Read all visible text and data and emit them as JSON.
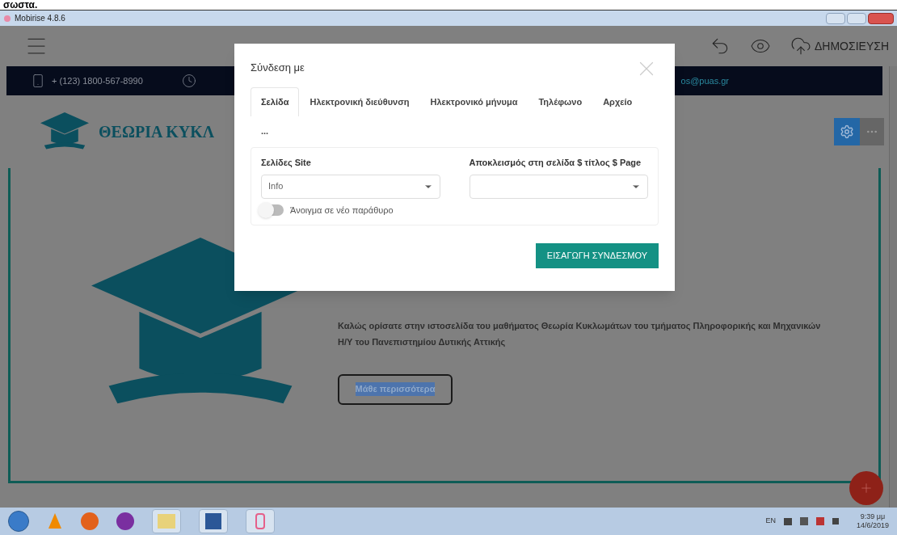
{
  "caption": "σωστα.",
  "window": {
    "title": "Mobirise 4.8.6"
  },
  "toolbar": {
    "publish": "ΔΗΜΟΣΙΕΥΣΗ"
  },
  "contact_bar": {
    "phone": "+ (123) 1800-567-8990",
    "email": "os@puas.gr"
  },
  "site": {
    "logo_text": "ΘΕΩΡΙΑ ΚΥΚΛ",
    "intro": "Καλώς ορίσατε στην ιστοσελίδα του μαθήματος Θεωρία Κυκλωμάτων του τμήματος Πληροφορικής και Μηχανικών Η/Υ του Πανεπιστημίου Δυτικής Αττικής",
    "button": {
      "label": "Μάθε περισσότερα",
      "highlighted": true
    }
  },
  "dialog": {
    "title": "Σύνδεση με",
    "tabs": [
      {
        "label": "Σελίδα",
        "selected": true
      },
      {
        "label": "Ηλεκτρονική διεύθυνση",
        "selected": false
      },
      {
        "label": "Ηλεκτρονικό μήνυμα",
        "selected": false
      },
      {
        "label": "Τηλέφωνο",
        "selected": false
      },
      {
        "label": "Αρχείο",
        "selected": false
      },
      {
        "label": "...",
        "selected": false
      }
    ],
    "fields": [
      {
        "label": "Σελίδες Site",
        "value": "Info"
      },
      {
        "label": "Αποκλεισμός στη σελίδα $ τίτλος $ Page"
      }
    ],
    "toggle": {
      "label": "Άνοιγμα σε νέο παράθυρο",
      "on": false
    },
    "submit": "ΕΙΣΑΓΩΓΗ ΣΥΝΔΕΣΜΟΥ"
  },
  "taskbar": {
    "language": "EN",
    "time": "9:39 μμ",
    "date": "14/6/2019"
  }
}
